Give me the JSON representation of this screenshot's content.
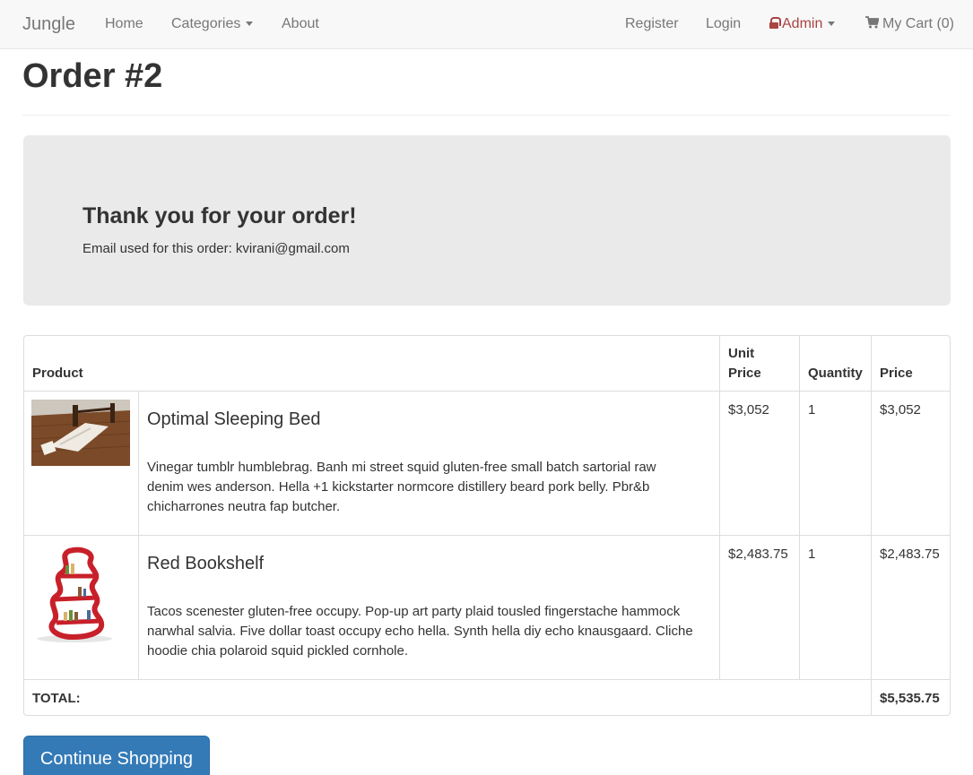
{
  "nav": {
    "brand": "Jungle",
    "home": "Home",
    "categories": "Categories",
    "about": "About",
    "register": "Register",
    "login": "Login",
    "admin": "Admin",
    "cart": "My Cart (0)"
  },
  "page": {
    "title": "Order #2"
  },
  "confirmation": {
    "heading": "Thank you for your order!",
    "email_line": "Email used for this order: kvirani@gmail.com"
  },
  "table": {
    "headers": {
      "product": "Product",
      "unit_price_1": "Unit",
      "unit_price_2": "Price",
      "quantity": "Quantity",
      "price": "Price"
    },
    "rows": [
      {
        "name": "Optimal Sleeping Bed",
        "description_lines": [
          "Vinegar tumblr humblebrag. Banh mi street squid gluten-free small batch sartorial raw",
          "denim wes anderson. Hella +1 kickstarter normcore distillery beard pork belly. Pbr&b",
          "chicharrones neutra fap butcher."
        ],
        "unit_price": "$3,052",
        "quantity": "1",
        "price": "$3,052"
      },
      {
        "name": "Red Bookshelf",
        "description_lines": [
          "Tacos scenester gluten-free occupy. Pop-up art party plaid tousled fingerstache hammock",
          "narwhal salvia. Five dollar toast occupy echo hella. Synth hella diy echo knausgaard. Cliche",
          "hoodie chia polaroid squid pickled cornhole."
        ],
        "unit_price": "$2,483.75",
        "quantity": "1",
        "price": "$2,483.75"
      }
    ],
    "total_label": "TOTAL:",
    "total_value": "$5,535.75"
  },
  "actions": {
    "continue_shopping": "Continue Shopping"
  },
  "colors": {
    "primary": "#337ab7",
    "admin": "#a94442",
    "jumbotron": "#eaeaea",
    "navbar": "#f8f8f8"
  }
}
